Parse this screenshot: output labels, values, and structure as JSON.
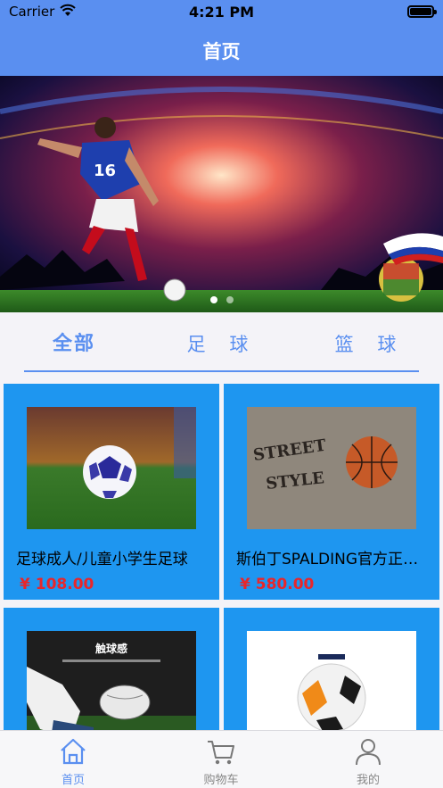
{
  "status_bar": {
    "carrier": "Carrier",
    "time": "4:21 PM"
  },
  "nav": {
    "title": "首页"
  },
  "banner": {
    "page_count": 2,
    "active_page": 1
  },
  "categories": [
    {
      "label": "全部",
      "active": true
    },
    {
      "label": "足 球",
      "active": false
    },
    {
      "label": "篮 球",
      "active": false
    }
  ],
  "products": [
    {
      "name": "足球成人/儿童小学生足球",
      "price": "¥ 108.00"
    },
    {
      "name": "斯伯丁SPALDING官方正品篮球",
      "price": "¥ 580.00"
    },
    {
      "name": "",
      "price": "",
      "image_caption": "触球感"
    },
    {
      "name": "",
      "price": ""
    }
  ],
  "tab_bar": {
    "items": [
      {
        "label": "首页",
        "icon": "home-icon",
        "active": true
      },
      {
        "label": "购物车",
        "icon": "cart-icon",
        "active": false
      },
      {
        "label": "我的",
        "icon": "user-icon",
        "active": false
      }
    ]
  },
  "colors": {
    "primary": "#5a8ff0",
    "card": "#1e96f0",
    "price": "#e8262b"
  }
}
